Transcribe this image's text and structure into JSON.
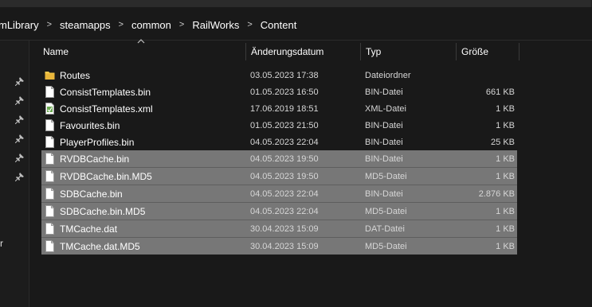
{
  "breadcrumb": {
    "items": [
      "mLibrary",
      "steamapps",
      "common",
      "RailWorks",
      "Content"
    ]
  },
  "columns": {
    "name": "Name",
    "date": "Änderungsdatum",
    "type": "Typ",
    "size": "Größe"
  },
  "files": [
    {
      "name": "Routes",
      "date": "03.05.2023 17:38",
      "type": "Dateiordner",
      "size": "",
      "icon": "folder-icon",
      "selected": false
    },
    {
      "name": "ConsistTemplates.bin",
      "date": "01.05.2023 16:50",
      "type": "BIN-Datei",
      "size": "661 KB",
      "icon": "file-icon",
      "selected": false
    },
    {
      "name": "ConsistTemplates.xml",
      "date": "17.06.2019 18:51",
      "type": "XML-Datei",
      "size": "1 KB",
      "icon": "xml-file-icon",
      "selected": false
    },
    {
      "name": "Favourites.bin",
      "date": "01.05.2023 21:50",
      "type": "BIN-Datei",
      "size": "1 KB",
      "icon": "file-icon",
      "selected": false
    },
    {
      "name": "PlayerProfiles.bin",
      "date": "04.05.2023 22:04",
      "type": "BIN-Datei",
      "size": "25 KB",
      "icon": "file-icon",
      "selected": false
    },
    {
      "name": "RVDBCache.bin",
      "date": "04.05.2023 19:50",
      "type": "BIN-Datei",
      "size": "1 KB",
      "icon": "file-icon",
      "selected": true
    },
    {
      "name": "RVDBCache.bin.MD5",
      "date": "04.05.2023 19:50",
      "type": "MD5-Datei",
      "size": "1 KB",
      "icon": "file-icon",
      "selected": true
    },
    {
      "name": "SDBCache.bin",
      "date": "04.05.2023 22:04",
      "type": "BIN-Datei",
      "size": "2.876 KB",
      "icon": "file-icon",
      "selected": true
    },
    {
      "name": "SDBCache.bin.MD5",
      "date": "04.05.2023 22:04",
      "type": "MD5-Datei",
      "size": "1 KB",
      "icon": "file-icon",
      "selected": true
    },
    {
      "name": "TMCache.dat",
      "date": "30.04.2023 15:09",
      "type": "DAT-Datei",
      "size": "1 KB",
      "icon": "file-icon",
      "selected": true
    },
    {
      "name": "TMCache.dat.MD5",
      "date": "30.04.2023 15:09",
      "type": "MD5-Datei",
      "size": "1 KB",
      "icon": "file-icon",
      "selected": true
    }
  ],
  "nav": {
    "partial_label": "r"
  },
  "colors": {
    "background": "#191919",
    "selection": "#777777",
    "folder": "#f2c94c"
  }
}
